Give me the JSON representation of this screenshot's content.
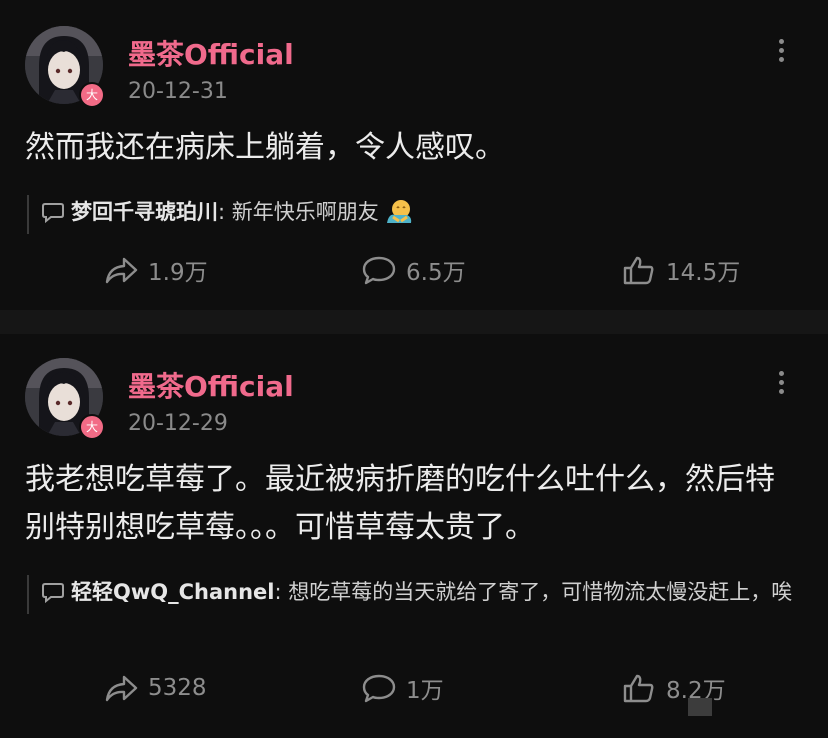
{
  "posts": [
    {
      "username": "墨茶Official",
      "badge": "大",
      "date": "20-12-31",
      "content": "然而我还在病床上躺着，令人感叹。",
      "comment": {
        "author": "梦回千寻琥珀川",
        "sep": ":",
        "text": " 新年快乐啊朋友",
        "emoji": "hug-emoji"
      },
      "stats": {
        "shares": "1.9万",
        "comments": "6.5万",
        "likes": "14.5万"
      }
    },
    {
      "username": "墨茶Official",
      "badge": "大",
      "date": "20-12-29",
      "content": "我老想吃草莓了。最近被病折磨的吃什么吐什么，然后特别特别想吃草莓。。。可惜草莓太贵了。",
      "comment": {
        "author": "轻轻QwQ_Channel",
        "sep": ":",
        "text": " 想吃草莓的当天就给了寄了，可惜物流太慢没赶上，唉"
      },
      "stats": {
        "shares": "5328",
        "comments": "1万",
        "likes": "8.2万"
      }
    }
  ],
  "colors": {
    "accent": "#f06a8c",
    "background": "#0e0e0e",
    "muted": "#8d8d8d"
  },
  "icons": [
    "share-icon",
    "comment-icon",
    "like-icon",
    "more-icon",
    "hug-emoji"
  ]
}
